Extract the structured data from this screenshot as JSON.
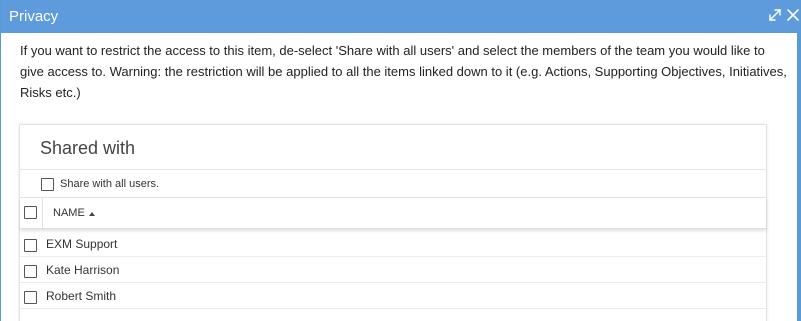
{
  "dialog": {
    "title": "Privacy",
    "icons": [
      "expand-icon",
      "close-icon"
    ],
    "intro_text": "If you want to restrict the access to this item, de-select 'Share with all users' and select the members of the team you would like to give access to. Warning: the restriction will be applied to all the items linked down to it (e.g. Actions, Supporting Objectives, Initiatives, Risks etc.)"
  },
  "shared_panel": {
    "title": "Shared with",
    "share_all_label": "Share with all users.",
    "share_all_checked": false,
    "columns": {
      "name": "NAME",
      "sort": "ascending"
    },
    "rows": [
      {
        "name": "EXM Support",
        "checked": false
      },
      {
        "name": "Kate Harrison",
        "checked": false
      },
      {
        "name": "Robert Smith",
        "checked": false
      }
    ]
  },
  "colors": {
    "titlebar": "#5d9bdc",
    "border": "#5b9bd5"
  }
}
